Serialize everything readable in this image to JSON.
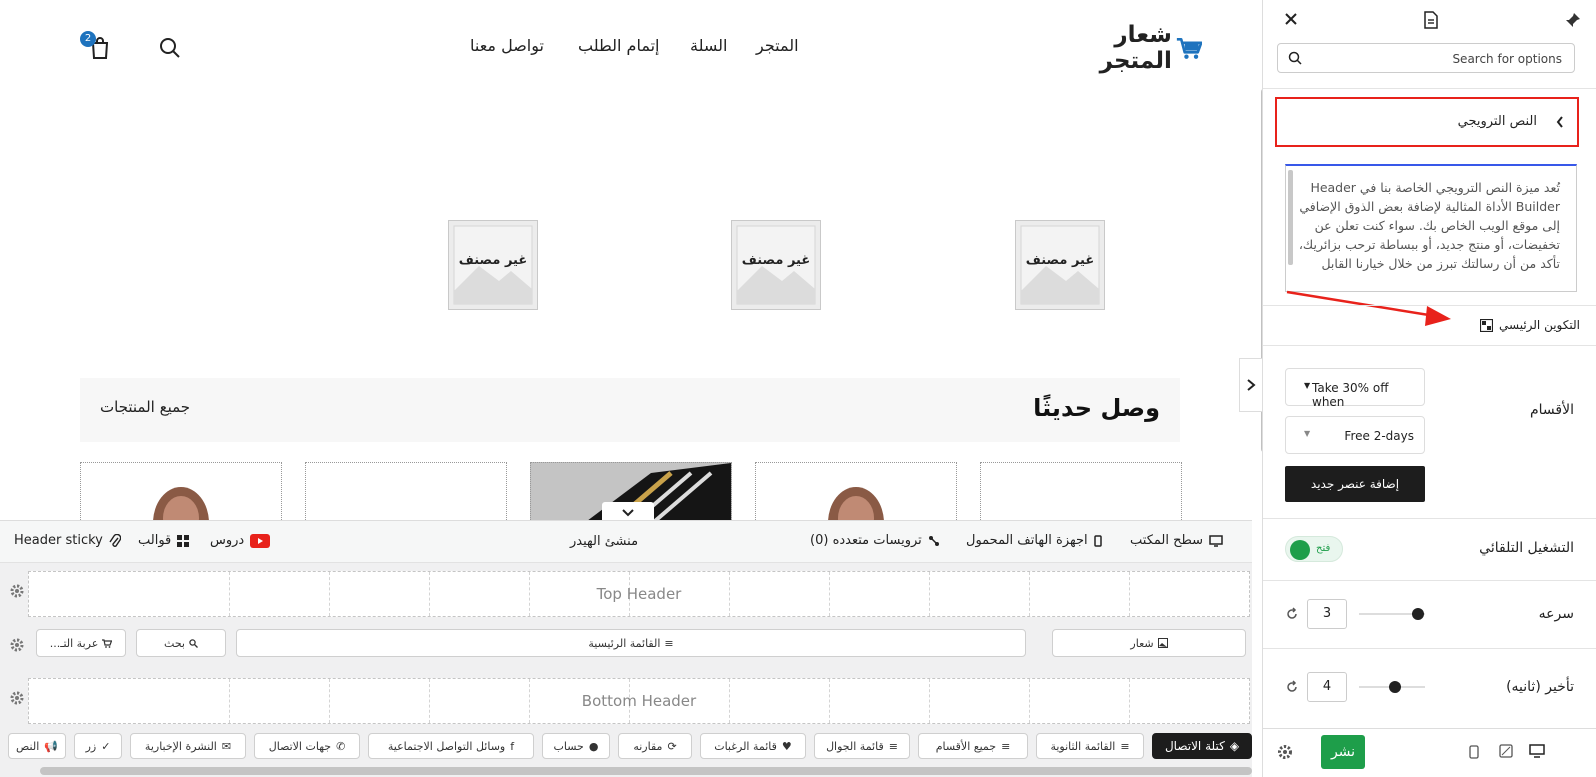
{
  "site": {
    "logo_text": "شعار المتجر",
    "nav": {
      "shop": "المتجر",
      "cart": "السلة",
      "checkout": "إتمام الطلب",
      "contact": "تواصل معنا"
    },
    "cart_count": "2",
    "categories": [
      "غير مصنف",
      "غير مصنف",
      "غير مصنف"
    ],
    "new_arrivals_title": "وصل حديثًا",
    "all_products_link": "جميع المنتجات"
  },
  "builder": {
    "toolbar": {
      "desktop": "سطح المكتب",
      "mobile": "اجهزة الهاتف المحمول",
      "multiple_headers": "ترويسات متعدده (0)",
      "title": "منشئ الهيدر",
      "tutorials": "دروس",
      "templates": "قوالب",
      "sticky": "Header sticky"
    },
    "rows": {
      "top": "Top Header",
      "bottom": "Bottom Header"
    },
    "main_row": {
      "logo": "شعار",
      "menu": "القائمة الرئيسية",
      "search": "بحث",
      "cart": "عربة التـ..."
    },
    "elements": [
      "كتلة الاتصال",
      "القائمة الثانوية",
      "جميع الأقسام",
      "قائمة الجوال",
      "قائمة الرغبات",
      "مقارنه",
      "حساب",
      "وسائل التواصل الاجتماعية",
      "جهات الاتصال",
      "النشرة الإخبارية",
      "زر",
      "النص"
    ]
  },
  "panel": {
    "search_placeholder": "Search for options",
    "section_title": "النص الترويجي",
    "description": "تُعد ميزة النص الترويجي الخاصة بنا في Header Builder الأداة المثالية لإضافة بعض الذوق الإضافي إلى موقع الويب الخاص بك. سواء كنت تعلن عن تخفيضات، أو منتج جديد، أو ببساطة ترحب بزائريك، تأكد من أن رسالتك تبرز من خلال خيارنا القابل",
    "layout_label": "التكوين الرئيسي",
    "sections_label": "الأقسام",
    "select_1": "Take 30% off when",
    "select_2": "Free 2-days",
    "add_button": "إضافة عنصر جديد",
    "autoplay_label": "التشغيل التلقائي",
    "autoplay_state": "فتح",
    "speed_label": "سرعه",
    "speed_value": "3",
    "speed_fraction": 0.9,
    "delay_label": "تأخير (ثانيه)",
    "delay_value": "4",
    "delay_fraction": 0.55,
    "publish": "نشر"
  },
  "colors": {
    "accent_red": "#e8221b",
    "publish_green": "#1e9e4a",
    "dark": "#1d1d1d",
    "badge_blue": "#1e73be"
  }
}
